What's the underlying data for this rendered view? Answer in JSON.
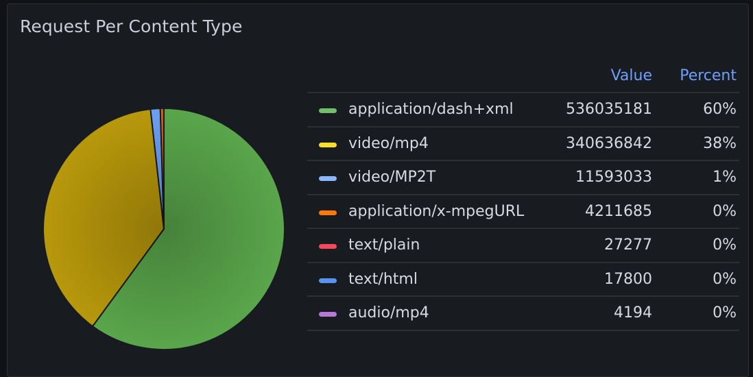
{
  "panel": {
    "title": "Request Per Content Type"
  },
  "legend": {
    "value_header": "Value",
    "percent_header": "Percent",
    "rows": [
      {
        "name": "application/dash+xml",
        "value": "536035181",
        "percent": "60%",
        "color": "#73bf69"
      },
      {
        "name": "video/mp4",
        "value": "340636842",
        "percent": "38%",
        "color": "#fade2a"
      },
      {
        "name": "video/MP2T",
        "value": "11593033",
        "percent": "1%",
        "color": "#8ab8ff"
      },
      {
        "name": "application/x-mpegURL",
        "value": "4211685",
        "percent": "0%",
        "color": "#ff780a"
      },
      {
        "name": "text/plain",
        "value": "27277",
        "percent": "0%",
        "color": "#f2495c"
      },
      {
        "name": "text/html",
        "value": "17800",
        "percent": "0%",
        "color": "#5794f2"
      },
      {
        "name": "audio/mp4",
        "value": "4194",
        "percent": "0%",
        "color": "#b877d9"
      }
    ]
  },
  "chart_data": {
    "type": "pie",
    "title": "Request Per Content Type",
    "legend_placement": "right",
    "series": [
      {
        "name": "application/dash+xml",
        "value": 536035181,
        "color": "#5aa64b"
      },
      {
        "name": "video/mp4",
        "value": 340636842,
        "color": "#b8980b"
      },
      {
        "name": "video/MP2T",
        "value": 11593033,
        "color": "#6b9ff2"
      },
      {
        "name": "application/x-mpegURL",
        "value": 4211685,
        "color": "#e0620a"
      },
      {
        "name": "text/plain",
        "value": 27277,
        "color": "#d9404f"
      },
      {
        "name": "text/html",
        "value": 17800,
        "color": "#4a80d9"
      },
      {
        "name": "audio/mp4",
        "value": 4194,
        "color": "#a065c2"
      }
    ]
  }
}
